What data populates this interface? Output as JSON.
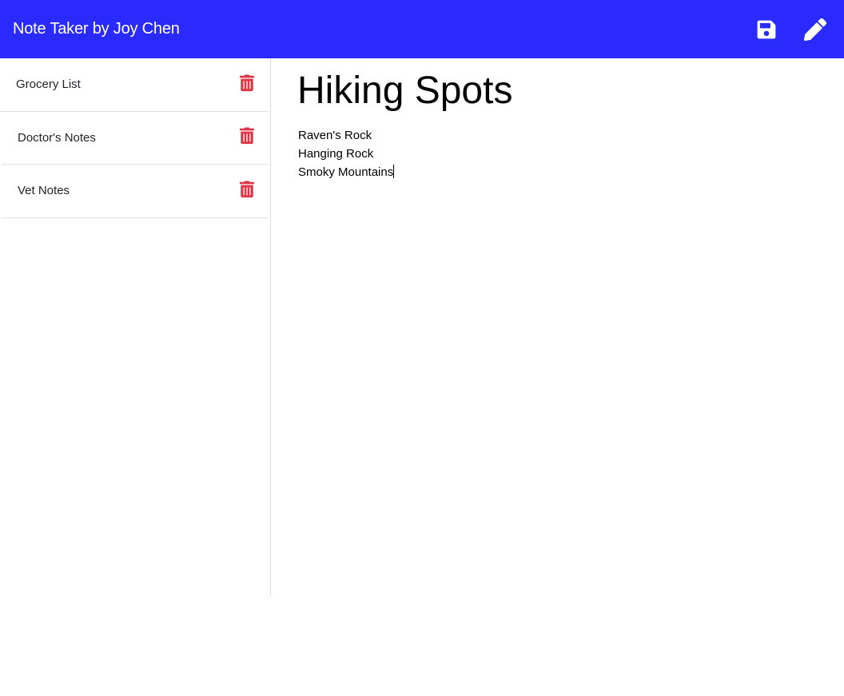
{
  "header": {
    "brand": "Note Taker by Joy Chen",
    "icons": {
      "save": "save-icon",
      "new_note": "pencil-icon"
    },
    "color": "#2a2afc"
  },
  "sidebar": {
    "notes": [
      {
        "title": "Grocery List",
        "delete_icon": "trash-icon"
      },
      {
        "title": "Doctor's Notes",
        "delete_icon": "trash-icon"
      },
      {
        "title": "Vet Notes",
        "delete_icon": "trash-icon"
      }
    ],
    "delete_color": "#dc3545"
  },
  "editor": {
    "title": "Hiking Spots",
    "lines": [
      "Raven's Rock",
      "Hanging Rock",
      "Smoky Mountains"
    ]
  }
}
